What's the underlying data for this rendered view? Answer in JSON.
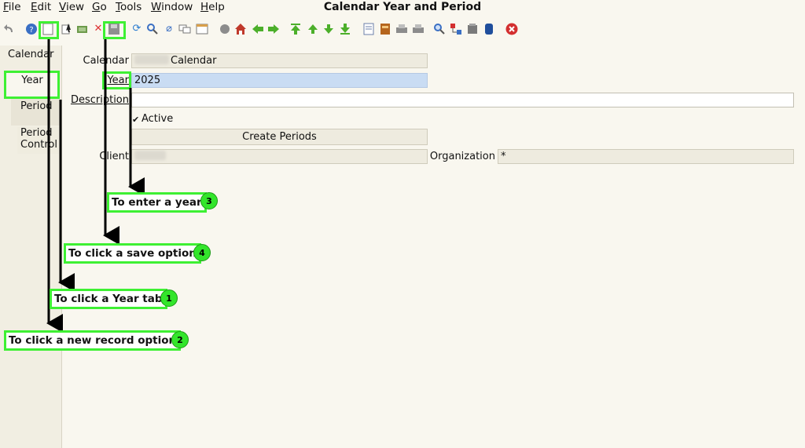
{
  "window": {
    "title": "Calendar Year and Period"
  },
  "menu": [
    {
      "mnemonic": "F",
      "rest": "ile"
    },
    {
      "mnemonic": "E",
      "rest": "dit"
    },
    {
      "mnemonic": "V",
      "rest": "iew"
    },
    {
      "mnemonic": "G",
      "rest": "o"
    },
    {
      "mnemonic": "T",
      "rest": "ools"
    },
    {
      "mnemonic": "W",
      "rest": "indow"
    },
    {
      "mnemonic": "H",
      "rest": "elp"
    }
  ],
  "tabs": {
    "calendar": "Calendar",
    "year": "Year",
    "period": "Period",
    "period_control_1": "Period",
    "period_control_2": "Control"
  },
  "form": {
    "calendar_label": "Calendar",
    "calendar_value": "Calendar",
    "year_label": "Year",
    "year_value": "2025",
    "description_label": "Description",
    "description_value": "",
    "active_label": "Active",
    "active_checked": true,
    "create_periods_label": "Create Periods",
    "client_label": "Client",
    "organization_label": "Organization",
    "organization_value": "*"
  },
  "annotations": {
    "step1": {
      "text": "To click a Year tab",
      "number": "1"
    },
    "step2": {
      "text": "To click a new record option",
      "number": "2"
    },
    "step3": {
      "text": "To enter a year",
      "number": "3"
    },
    "step4": {
      "text": "To click a save option",
      "number": "4"
    }
  },
  "colors": {
    "highlight": "#3ef033",
    "badge": "#33e52b",
    "year_field": "#c9dcf3",
    "background": "#f9f7ef"
  }
}
